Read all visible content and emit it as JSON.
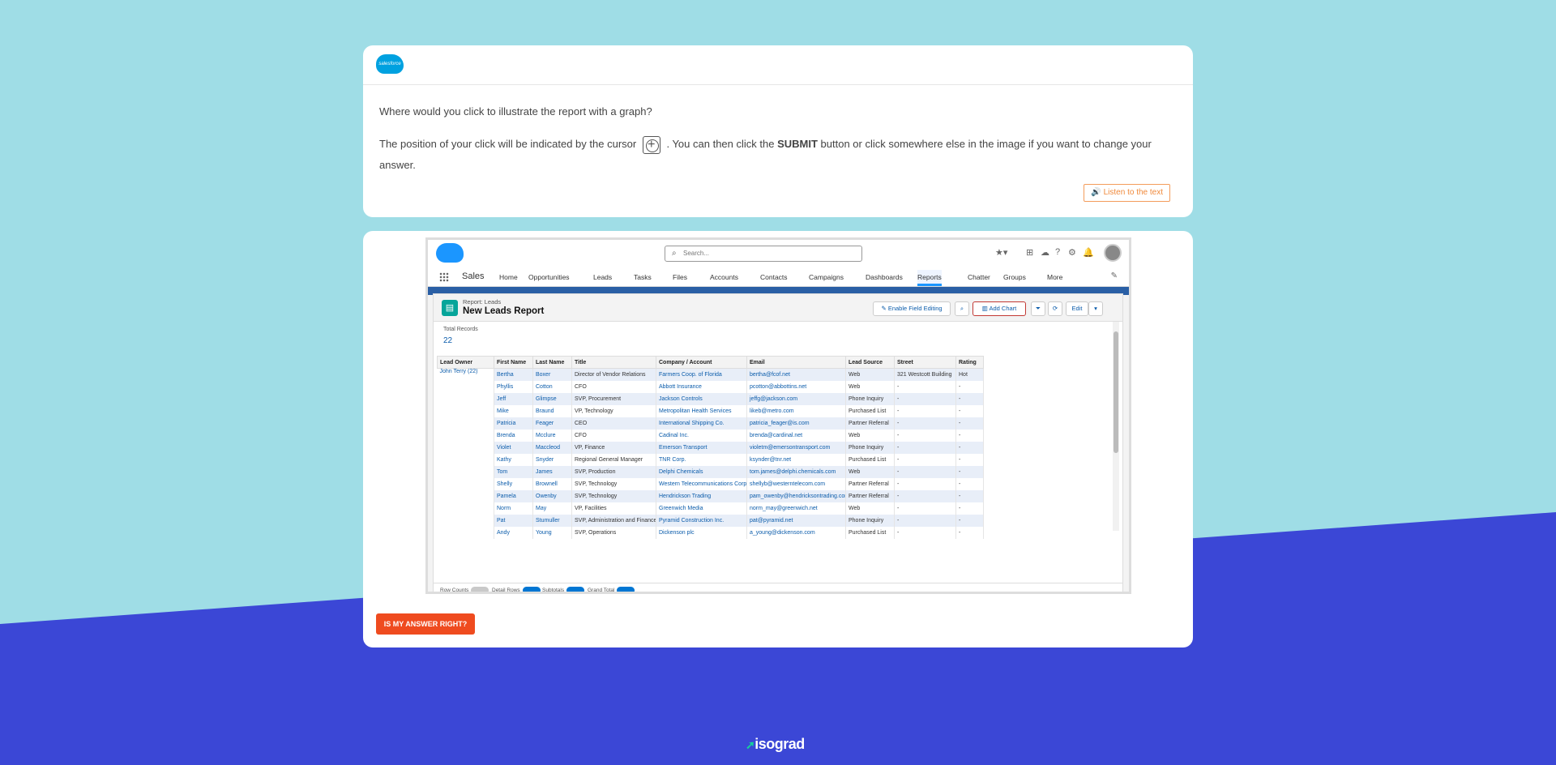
{
  "question": {
    "text": "Where would you click to illustrate the report with a graph?",
    "instruction_prefix": "The position of your click will be indicated by the cursor",
    "instruction_middle": ". You can then click the",
    "instruction_bold": "SUBMIT",
    "instruction_suffix": "button or click somewhere else in the image if you want to change your answer.",
    "listen_label": "Listen to the text",
    "logo_text": "salesforce"
  },
  "salesforce": {
    "search_placeholder": "Search...",
    "app_name": "Sales",
    "nav": [
      "Home",
      "Opportunities",
      "Leads",
      "Tasks",
      "Files",
      "Accounts",
      "Contacts",
      "Campaigns",
      "Dashboards",
      "Reports",
      "Chatter",
      "Groups",
      "More"
    ],
    "report": {
      "subtitle": "Report: Leads",
      "title": "New Leads Report",
      "btn_edit_fields": "Enable Field Editing",
      "btn_add_chart": "Add Chart",
      "btn_edit": "Edit",
      "totals_label": "Total Records",
      "totals_value": "22",
      "columns": [
        "Lead Owner",
        "First Name",
        "Last Name",
        "Title",
        "Company / Account",
        "Email",
        "Lead Source",
        "Street",
        "Rating"
      ],
      "owner": "John Terry (22)",
      "rows": [
        [
          "Bertha",
          "Boxer",
          "Director of Vendor Relations",
          "Farmers Coop. of Florida",
          "bertha@fcof.net",
          "Web",
          "321 Westcott Building",
          "Hot"
        ],
        [
          "Phyllis",
          "Cotton",
          "CFO",
          "Abbott Insurance",
          "pcotton@abbottins.net",
          "Web",
          "-",
          "-"
        ],
        [
          "Jeff",
          "Glimpse",
          "SVP, Procurement",
          "Jackson Controls",
          "jeffg@jackson.com",
          "Phone Inquiry",
          "-",
          "-"
        ],
        [
          "Mike",
          "Braund",
          "VP, Technology",
          "Metropolitan Health Services",
          "likeb@metro.com",
          "Purchased List",
          "-",
          "-"
        ],
        [
          "Patricia",
          "Feager",
          "CEO",
          "International Shipping Co.",
          "patricia_feager@is.com",
          "Partner Referral",
          "-",
          "-"
        ],
        [
          "Brenda",
          "Mcclure",
          "CFO",
          "Cadinal Inc.",
          "brenda@cardinal.net",
          "Web",
          "-",
          "-"
        ],
        [
          "Violet",
          "Maccleod",
          "VP, Finance",
          "Emerson Transport",
          "violetm@emersontransport.com",
          "Phone Inquiry",
          "-",
          "-"
        ],
        [
          "Kathy",
          "Snyder",
          "Regional General Manager",
          "TNR Corp.",
          "ksynder@tnr.net",
          "Purchased List",
          "-",
          "-"
        ],
        [
          "Tom",
          "James",
          "SVP, Production",
          "Delphi Chemicals",
          "tom.james@delphi.chemicals.com",
          "Web",
          "-",
          "-"
        ],
        [
          "Shelly",
          "Brownell",
          "SVP, Technology",
          "Western Telecommunications Corp.",
          "shellyb@westerntelecom.com",
          "Partner Referral",
          "-",
          "-"
        ],
        [
          "Pamela",
          "Owenby",
          "SVP, Technology",
          "Hendrickson Trading",
          "pam_owenby@hendricksontrading.com",
          "Partner Referral",
          "-",
          "-"
        ],
        [
          "Norm",
          "May",
          "VP, Facilities",
          "Greenwich Media",
          "norm_may@greenwich.net",
          "Web",
          "-",
          "-"
        ],
        [
          "Pat",
          "Stumuller",
          "SVP, Administration and Finance",
          "Pyramid Construction Inc.",
          "pat@pyramid.net",
          "Phone Inquiry",
          "-",
          "-"
        ],
        [
          "Andy",
          "Young",
          "SVP, Operations",
          "Dickenson plc",
          "a_young@dickenson.com",
          "Purchased List",
          "-",
          "-"
        ]
      ],
      "footer": [
        "Row Counts",
        "Detail Rows",
        "Subtotals",
        "Grand Total"
      ]
    }
  },
  "submit_label": "IS MY ANSWER RIGHT?",
  "brand": "isograd"
}
